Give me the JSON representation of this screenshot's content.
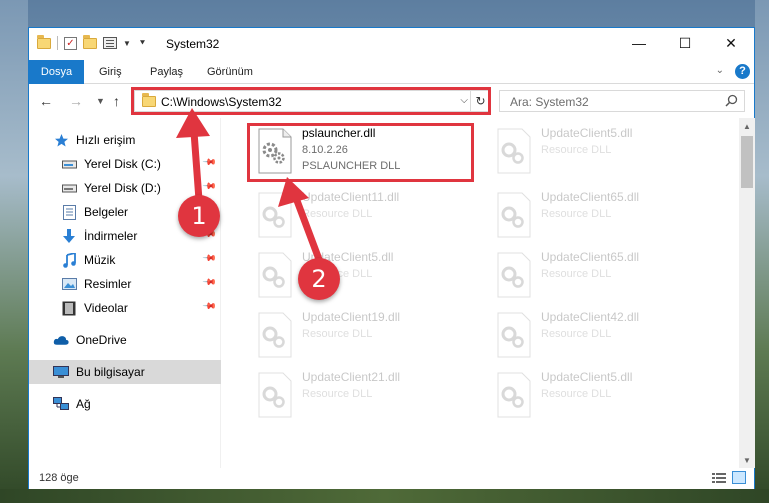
{
  "window": {
    "title": "System32",
    "controls": {
      "minimize": "—",
      "maximize": "☐",
      "close": "✕"
    }
  },
  "ribbon": {
    "tabs": [
      "Dosya",
      "Giriş",
      "Paylaş",
      "Görünüm"
    ],
    "help": "?"
  },
  "address_bar": {
    "path": "C:\\Windows\\System32",
    "dropdown": "⌵",
    "refresh": "↻"
  },
  "search": {
    "placeholder": "Ara: System32"
  },
  "sidebar": {
    "quick_access": "Hızlı erişim",
    "items": [
      {
        "label": "Yerel Disk (C:)",
        "icon": "drive-icon",
        "pinned": true
      },
      {
        "label": "Yerel Disk (D:)",
        "icon": "drive-icon",
        "pinned": true
      },
      {
        "label": "Belgeler",
        "icon": "documents-icon",
        "pinned": true
      },
      {
        "label": "İndirmeler",
        "icon": "downloads-icon",
        "pinned": true
      },
      {
        "label": "Müzik",
        "icon": "music-icon",
        "pinned": true
      },
      {
        "label": "Resimler",
        "icon": "pictures-icon",
        "pinned": true
      },
      {
        "label": "Videolar",
        "icon": "videos-icon",
        "pinned": true
      }
    ],
    "onedrive": "OneDrive",
    "this_pc": "Bu bilgisayar",
    "network": "Ağ"
  },
  "files": [
    {
      "name": "pslauncher.dll",
      "version": "8.10.2.26",
      "description": "PSLAUNCHER DLL",
      "highlighted": true
    },
    {
      "name": "UpdateClient5.dll",
      "description": "Resource DLL"
    },
    {
      "name": "UpdateClient11.dll",
      "description": "Resource DLL"
    },
    {
      "name": "UpdateClient65.dll",
      "description": "Resource DLL"
    },
    {
      "name": "UpdateClient5.dll",
      "description": "Resource DLL"
    },
    {
      "name": "UpdateClient65.dll",
      "description": "Resource DLL"
    },
    {
      "name": "UpdateClient19.dll",
      "description": "Resource DLL"
    },
    {
      "name": "UpdateClient42.dll",
      "description": "Resource DLL"
    },
    {
      "name": "UpdateClient21.dll",
      "description": "Resource DLL"
    },
    {
      "name": "UpdateClient5.dll",
      "description": "Resource DLL"
    }
  ],
  "status": {
    "item_count": "128 öge"
  },
  "annotations": {
    "step1": "1",
    "step2": "2",
    "color": "#e0353f"
  }
}
